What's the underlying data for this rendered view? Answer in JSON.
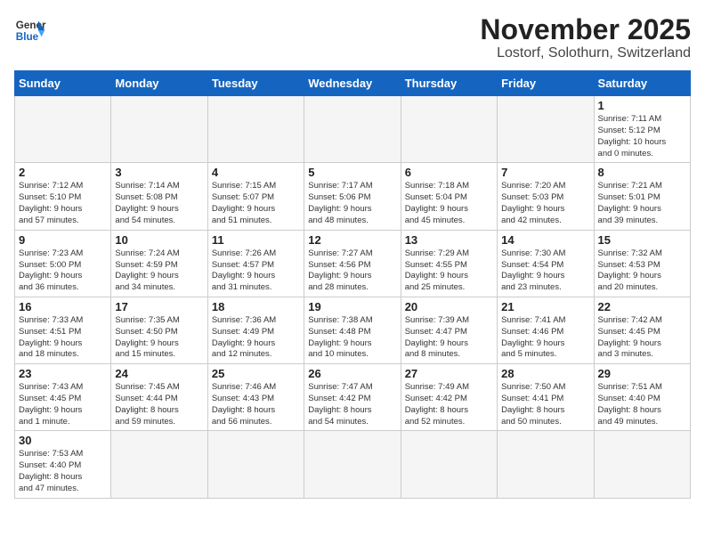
{
  "header": {
    "logo_general": "General",
    "logo_blue": "Blue",
    "title": "November 2025",
    "subtitle": "Lostorf, Solothurn, Switzerland"
  },
  "weekdays": [
    "Sunday",
    "Monday",
    "Tuesday",
    "Wednesday",
    "Thursday",
    "Friday",
    "Saturday"
  ],
  "weeks": [
    [
      {
        "day": "",
        "info": ""
      },
      {
        "day": "",
        "info": ""
      },
      {
        "day": "",
        "info": ""
      },
      {
        "day": "",
        "info": ""
      },
      {
        "day": "",
        "info": ""
      },
      {
        "day": "",
        "info": ""
      },
      {
        "day": "1",
        "info": "Sunrise: 7:11 AM\nSunset: 5:12 PM\nDaylight: 10 hours\nand 0 minutes."
      }
    ],
    [
      {
        "day": "2",
        "info": "Sunrise: 7:12 AM\nSunset: 5:10 PM\nDaylight: 9 hours\nand 57 minutes."
      },
      {
        "day": "3",
        "info": "Sunrise: 7:14 AM\nSunset: 5:08 PM\nDaylight: 9 hours\nand 54 minutes."
      },
      {
        "day": "4",
        "info": "Sunrise: 7:15 AM\nSunset: 5:07 PM\nDaylight: 9 hours\nand 51 minutes."
      },
      {
        "day": "5",
        "info": "Sunrise: 7:17 AM\nSunset: 5:06 PM\nDaylight: 9 hours\nand 48 minutes."
      },
      {
        "day": "6",
        "info": "Sunrise: 7:18 AM\nSunset: 5:04 PM\nDaylight: 9 hours\nand 45 minutes."
      },
      {
        "day": "7",
        "info": "Sunrise: 7:20 AM\nSunset: 5:03 PM\nDaylight: 9 hours\nand 42 minutes."
      },
      {
        "day": "8",
        "info": "Sunrise: 7:21 AM\nSunset: 5:01 PM\nDaylight: 9 hours\nand 39 minutes."
      }
    ],
    [
      {
        "day": "9",
        "info": "Sunrise: 7:23 AM\nSunset: 5:00 PM\nDaylight: 9 hours\nand 36 minutes."
      },
      {
        "day": "10",
        "info": "Sunrise: 7:24 AM\nSunset: 4:59 PM\nDaylight: 9 hours\nand 34 minutes."
      },
      {
        "day": "11",
        "info": "Sunrise: 7:26 AM\nSunset: 4:57 PM\nDaylight: 9 hours\nand 31 minutes."
      },
      {
        "day": "12",
        "info": "Sunrise: 7:27 AM\nSunset: 4:56 PM\nDaylight: 9 hours\nand 28 minutes."
      },
      {
        "day": "13",
        "info": "Sunrise: 7:29 AM\nSunset: 4:55 PM\nDaylight: 9 hours\nand 25 minutes."
      },
      {
        "day": "14",
        "info": "Sunrise: 7:30 AM\nSunset: 4:54 PM\nDaylight: 9 hours\nand 23 minutes."
      },
      {
        "day": "15",
        "info": "Sunrise: 7:32 AM\nSunset: 4:53 PM\nDaylight: 9 hours\nand 20 minutes."
      }
    ],
    [
      {
        "day": "16",
        "info": "Sunrise: 7:33 AM\nSunset: 4:51 PM\nDaylight: 9 hours\nand 18 minutes."
      },
      {
        "day": "17",
        "info": "Sunrise: 7:35 AM\nSunset: 4:50 PM\nDaylight: 9 hours\nand 15 minutes."
      },
      {
        "day": "18",
        "info": "Sunrise: 7:36 AM\nSunset: 4:49 PM\nDaylight: 9 hours\nand 12 minutes."
      },
      {
        "day": "19",
        "info": "Sunrise: 7:38 AM\nSunset: 4:48 PM\nDaylight: 9 hours\nand 10 minutes."
      },
      {
        "day": "20",
        "info": "Sunrise: 7:39 AM\nSunset: 4:47 PM\nDaylight: 9 hours\nand 8 minutes."
      },
      {
        "day": "21",
        "info": "Sunrise: 7:41 AM\nSunset: 4:46 PM\nDaylight: 9 hours\nand 5 minutes."
      },
      {
        "day": "22",
        "info": "Sunrise: 7:42 AM\nSunset: 4:45 PM\nDaylight: 9 hours\nand 3 minutes."
      }
    ],
    [
      {
        "day": "23",
        "info": "Sunrise: 7:43 AM\nSunset: 4:45 PM\nDaylight: 9 hours\nand 1 minute."
      },
      {
        "day": "24",
        "info": "Sunrise: 7:45 AM\nSunset: 4:44 PM\nDaylight: 8 hours\nand 59 minutes."
      },
      {
        "day": "25",
        "info": "Sunrise: 7:46 AM\nSunset: 4:43 PM\nDaylight: 8 hours\nand 56 minutes."
      },
      {
        "day": "26",
        "info": "Sunrise: 7:47 AM\nSunset: 4:42 PM\nDaylight: 8 hours\nand 54 minutes."
      },
      {
        "day": "27",
        "info": "Sunrise: 7:49 AM\nSunset: 4:42 PM\nDaylight: 8 hours\nand 52 minutes."
      },
      {
        "day": "28",
        "info": "Sunrise: 7:50 AM\nSunset: 4:41 PM\nDaylight: 8 hours\nand 50 minutes."
      },
      {
        "day": "29",
        "info": "Sunrise: 7:51 AM\nSunset: 4:40 PM\nDaylight: 8 hours\nand 49 minutes."
      }
    ],
    [
      {
        "day": "30",
        "info": "Sunrise: 7:53 AM\nSunset: 4:40 PM\nDaylight: 8 hours\nand 47 minutes."
      },
      {
        "day": "",
        "info": ""
      },
      {
        "day": "",
        "info": ""
      },
      {
        "day": "",
        "info": ""
      },
      {
        "day": "",
        "info": ""
      },
      {
        "day": "",
        "info": ""
      },
      {
        "day": "",
        "info": ""
      }
    ]
  ]
}
